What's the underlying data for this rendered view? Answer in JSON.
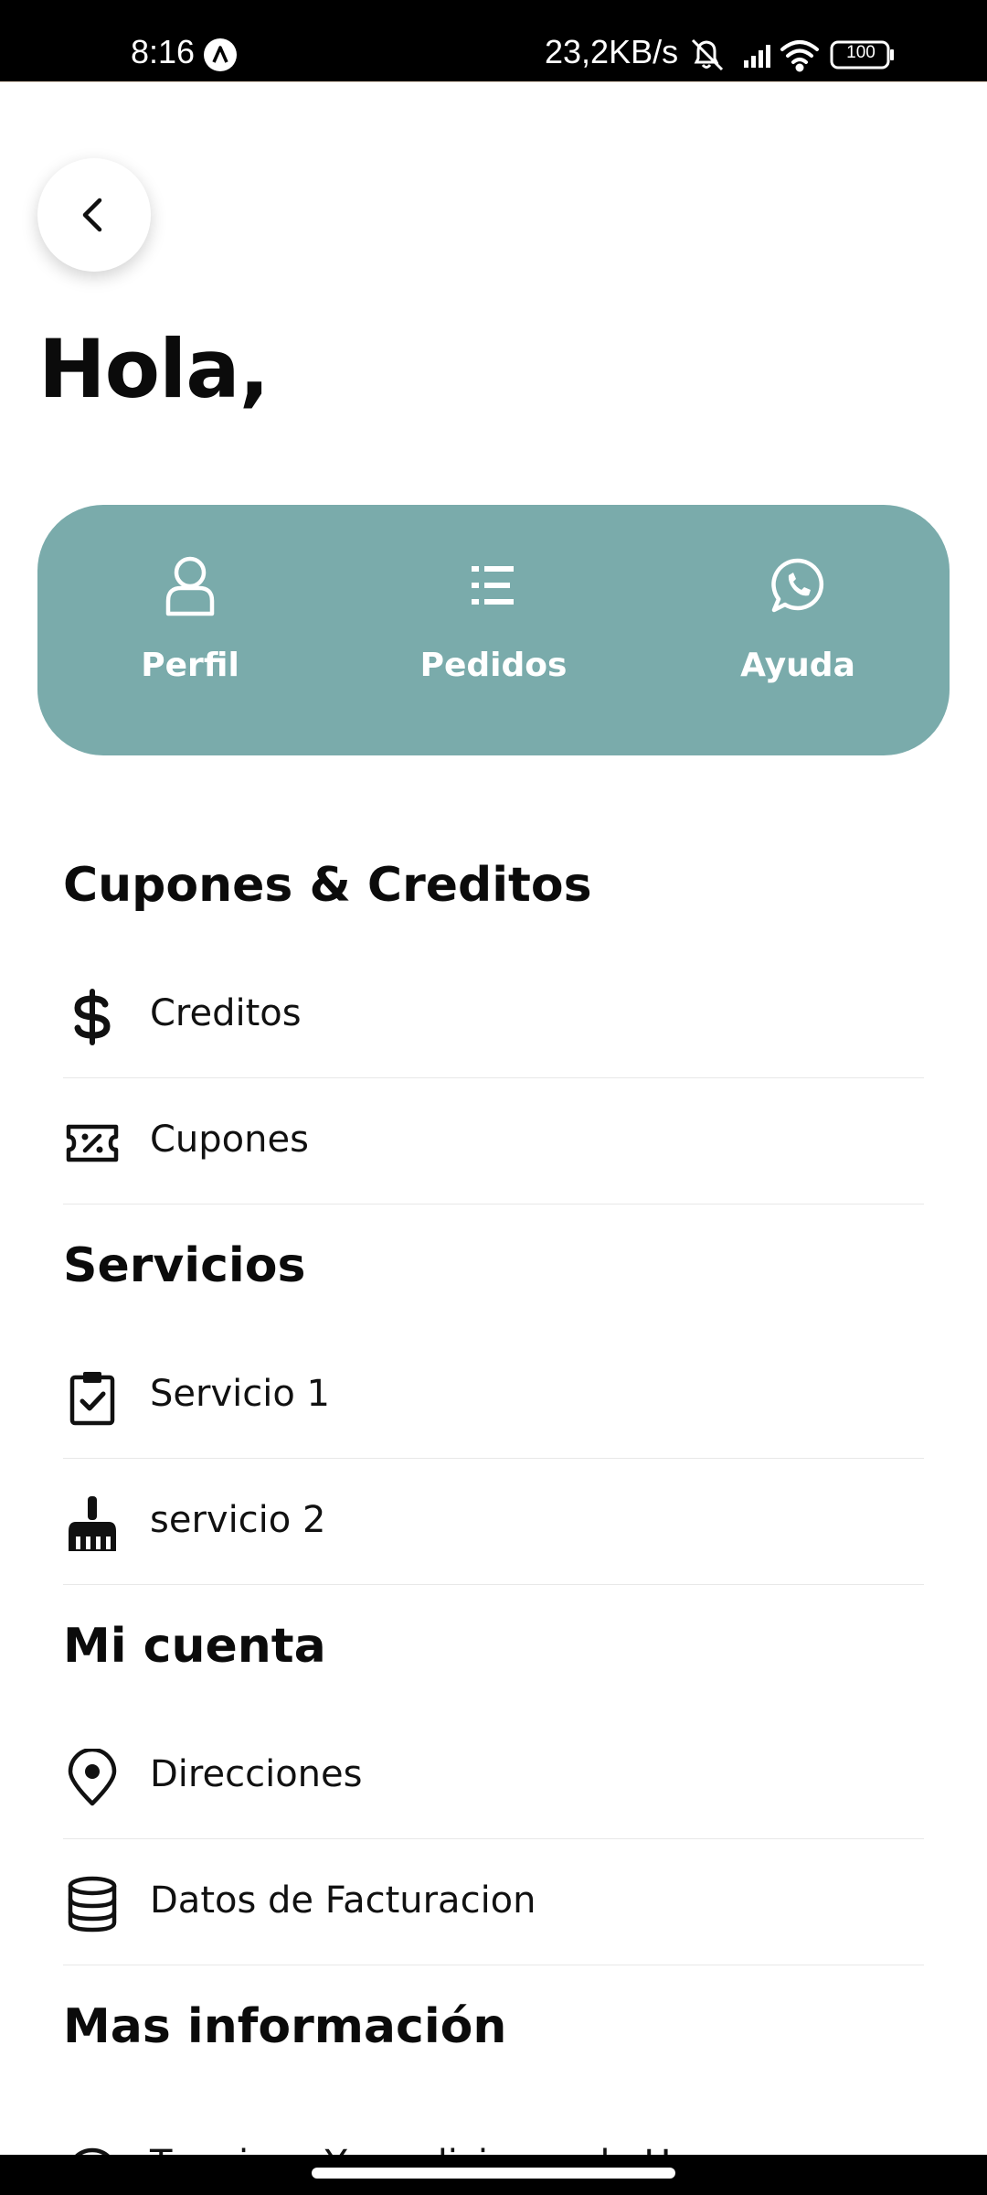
{
  "status_bar": {
    "time": "8:16",
    "network_speed": "23,2KB/s",
    "battery": "100",
    "icons": [
      "notifications-muted-icon",
      "signal-icon",
      "wifi-icon",
      "battery-icon"
    ]
  },
  "header": {
    "greeting": "Hola,"
  },
  "quick_actions": [
    {
      "label": "Perfil",
      "icon": "user-icon"
    },
    {
      "label": "Pedidos",
      "icon": "list-icon"
    },
    {
      "label": "Ayuda",
      "icon": "whatsapp-icon"
    }
  ],
  "sections": {
    "coupons": {
      "title": "Cupones & Creditos",
      "items": [
        {
          "label": "Creditos",
          "icon": "dollar-icon"
        },
        {
          "label": "Cupones",
          "icon": "ticket-percent-icon"
        }
      ]
    },
    "services": {
      "title": "Servicios",
      "items": [
        {
          "label": "Servicio 1",
          "icon": "clipboard-check-icon"
        },
        {
          "label": "servicio 2",
          "icon": "broom-icon"
        }
      ]
    },
    "account": {
      "title": "Mi cuenta",
      "items": [
        {
          "label": "Direcciones",
          "icon": "map-pin-icon"
        },
        {
          "label": "Datos de Facturacion",
          "icon": "database-icon"
        }
      ]
    },
    "more_info": {
      "title": "Mas información",
      "items": [
        {
          "label": "Terminos Y condiciones de Uso",
          "icon": "info-icon"
        }
      ]
    }
  },
  "colors": {
    "accent": "#7aabab",
    "text": "#0b0b0b",
    "divider": "#e8e8e8",
    "status_bar_bg": "#000000"
  }
}
